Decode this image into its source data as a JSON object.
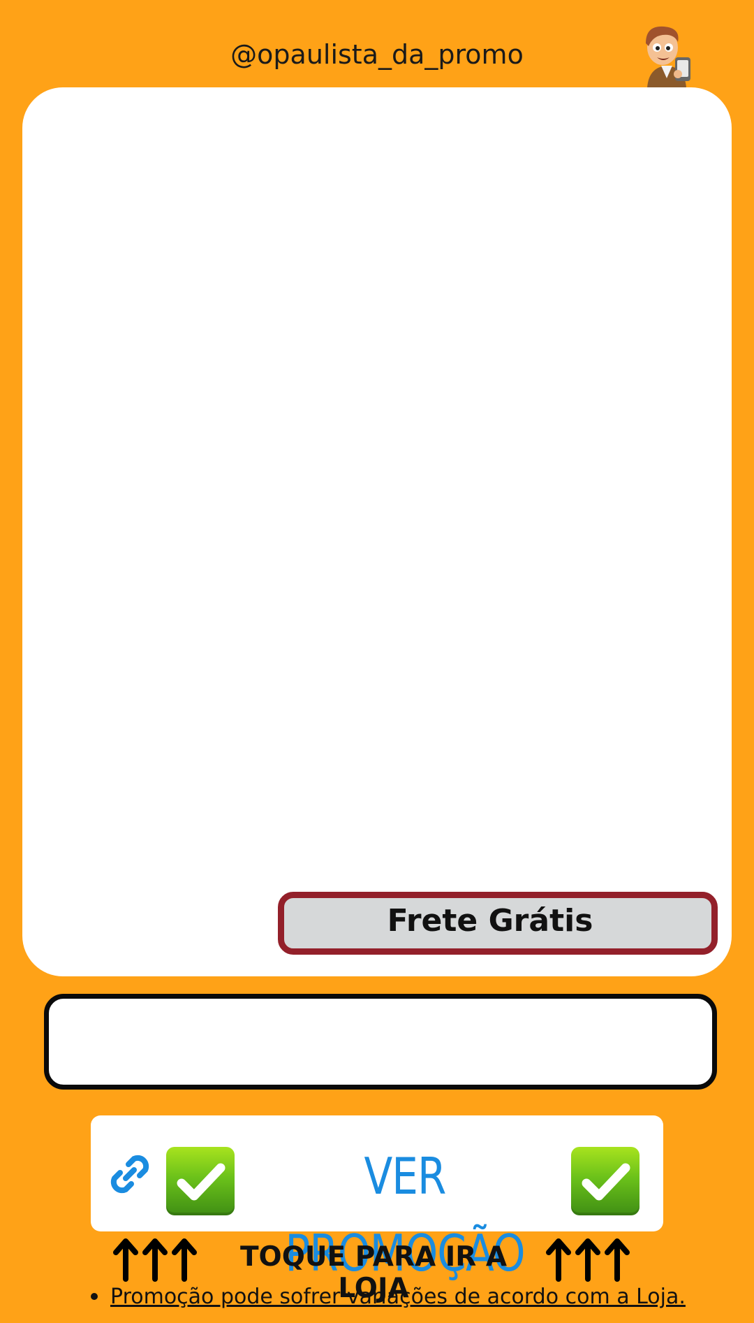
{
  "header": {
    "handle": "@opaulista_da_promo",
    "mascot_icon": "cartoon-mascot-icon"
  },
  "product": {
    "shipping_badge": "Frete Grátis",
    "description": ""
  },
  "cta": {
    "label": "VER PROMOÇÃO",
    "link_icon": "link-icon",
    "check_icon": "check-mark-icon"
  },
  "tap_hint": {
    "text": "TOQUE PARA IR A LOJA",
    "arrows": "↑↑↑"
  },
  "disclaimer": {
    "text": "Promoção pode sofrer variações de acordo com a Loja."
  },
  "colors": {
    "background": "#FFA217",
    "badge_border": "#93202A",
    "badge_fill": "#D6D8D9",
    "cta_text": "#1A8CE0"
  }
}
